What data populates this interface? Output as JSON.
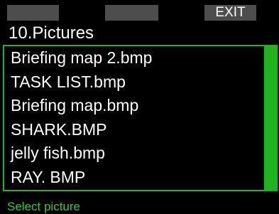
{
  "softkeys": {
    "left": "",
    "middle": "",
    "right": "EXIT"
  },
  "header": {
    "title": "10.Pictures"
  },
  "pictures": {
    "items": [
      "Briefing map 2.bmp",
      "TASK LIST.bmp",
      "Briefing map.bmp",
      "SHARK.BMP",
      "jelly fish.bmp",
      "RAY. BMP"
    ]
  },
  "footer": {
    "hint": "Select picture"
  },
  "colors": {
    "accent": "#1fb41f",
    "hint_text": "#2bd22b",
    "softkey_bg": "#4d4d4d",
    "background": "#000000"
  }
}
